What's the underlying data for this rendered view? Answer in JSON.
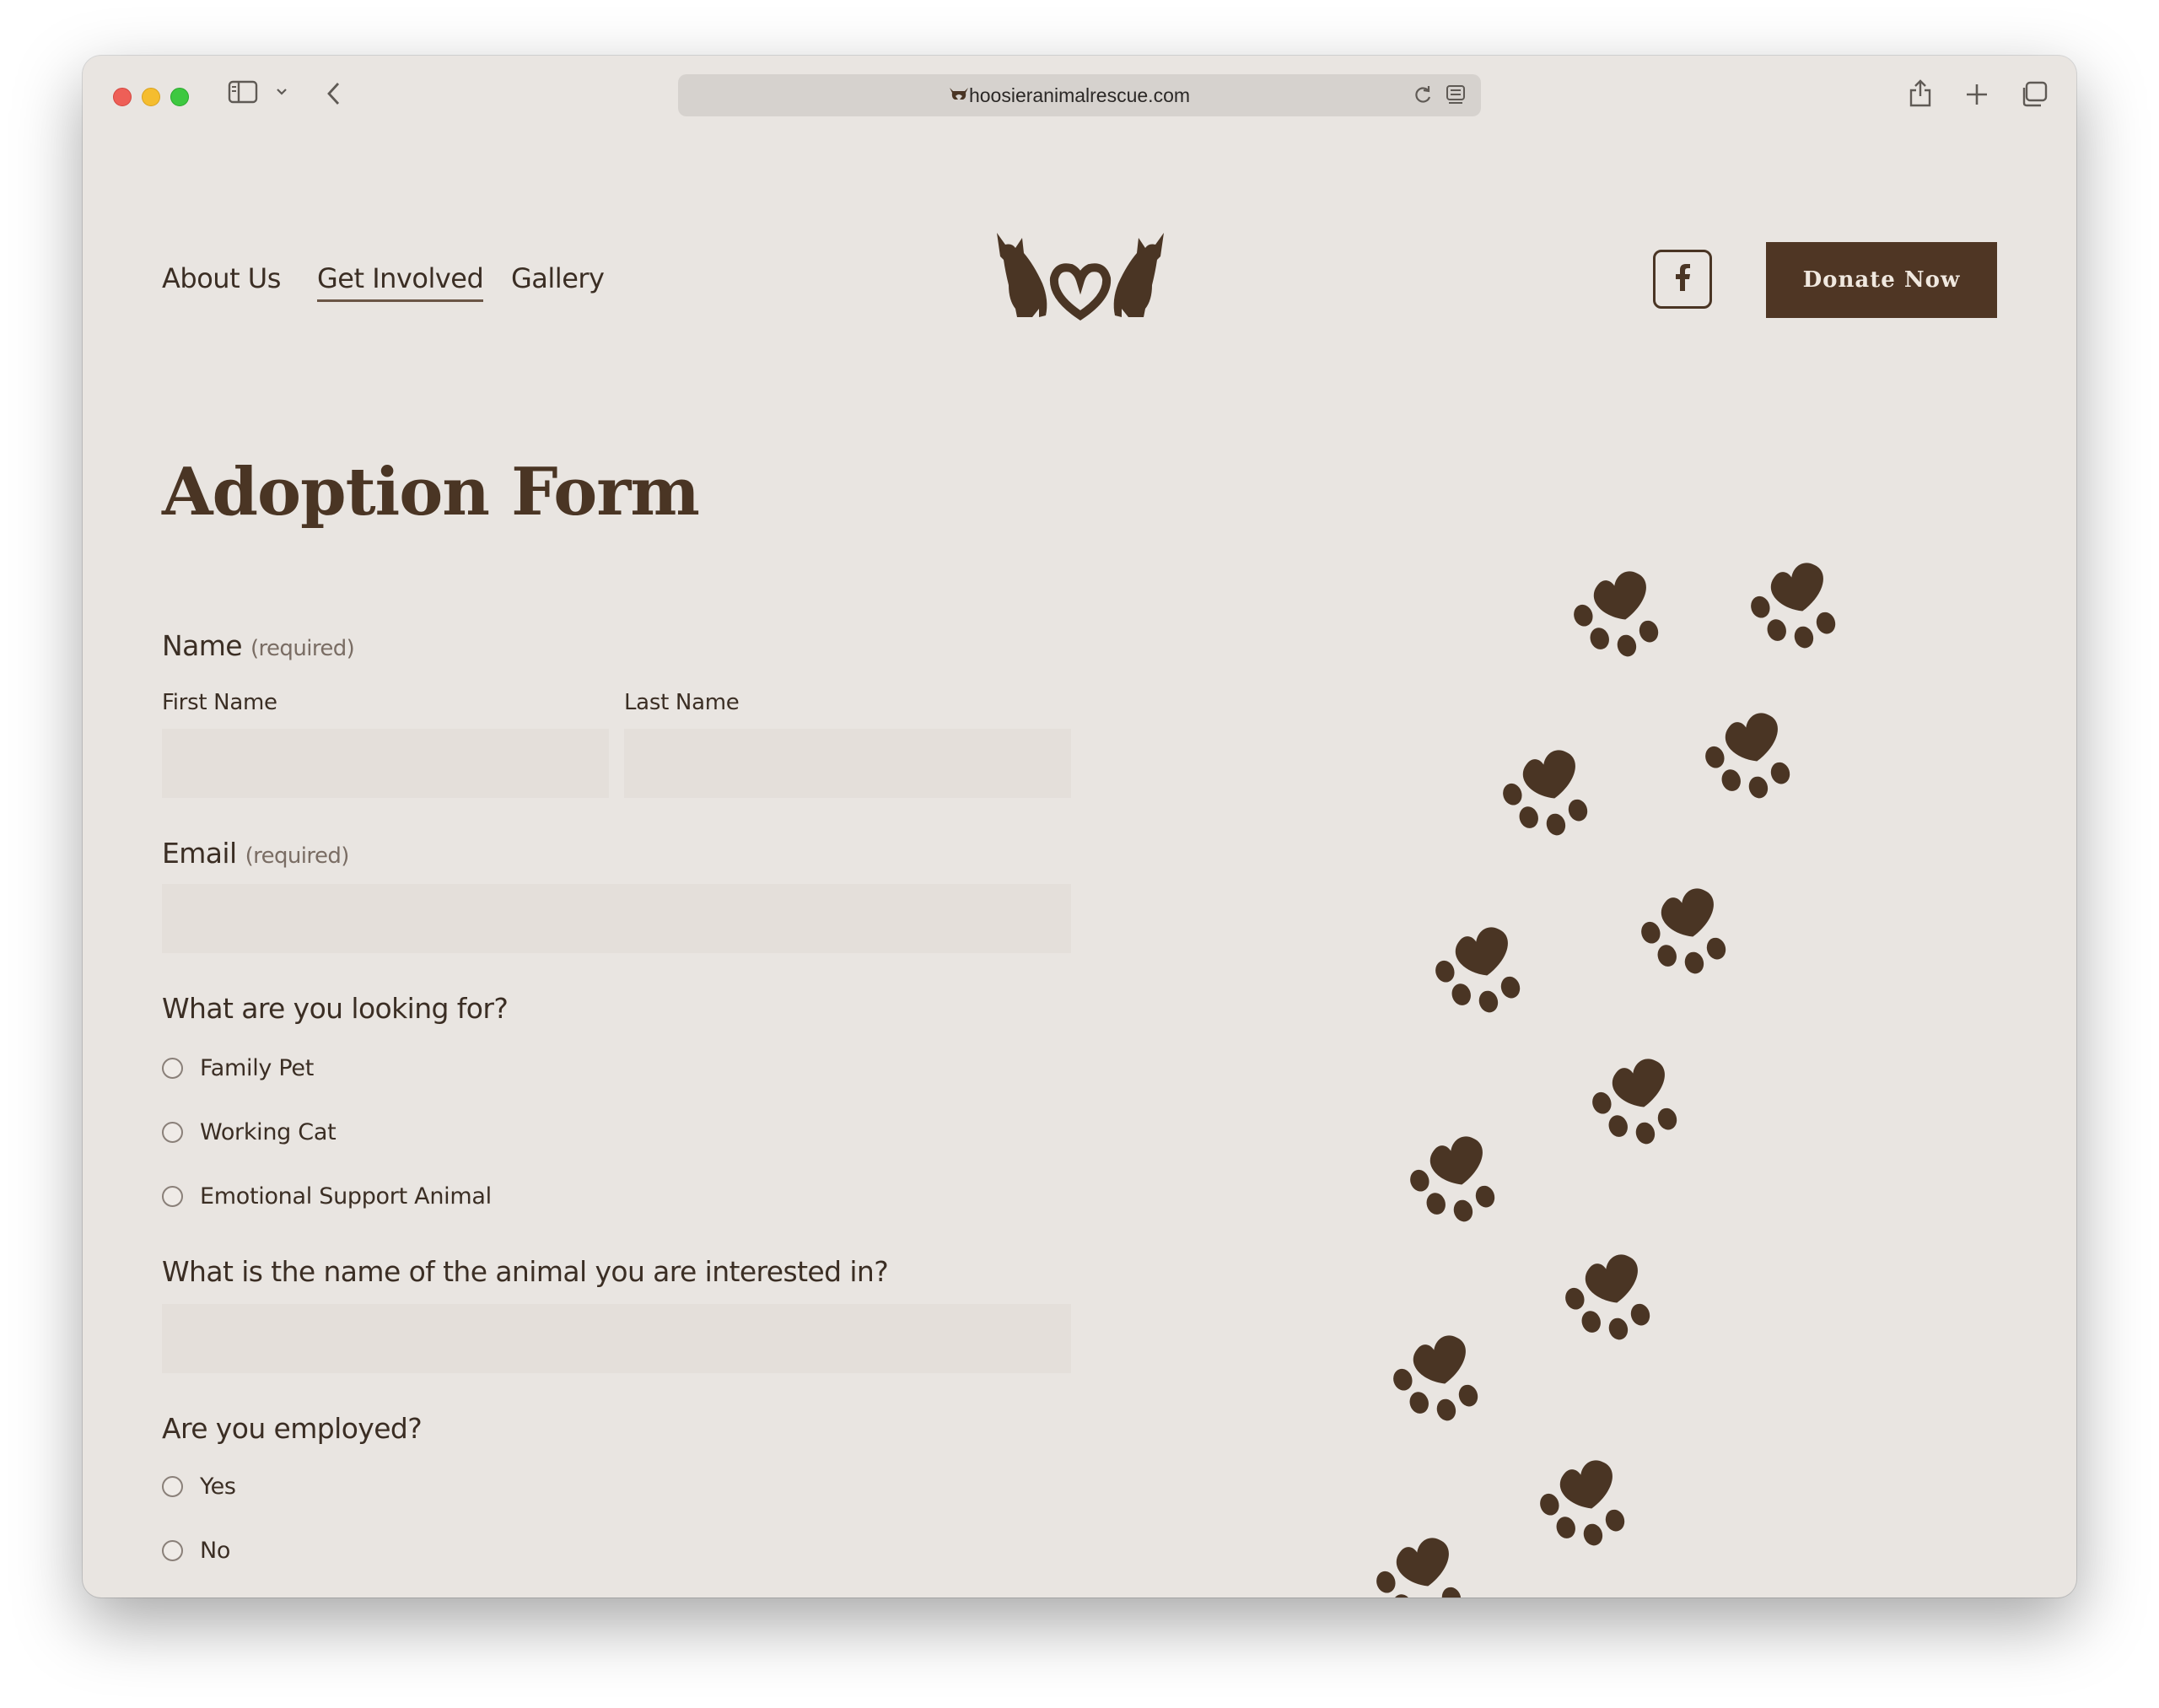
{
  "browser": {
    "url": "hoosieranimalrescue.com"
  },
  "nav": {
    "items": [
      {
        "label": "About Us"
      },
      {
        "label": "Get Involved"
      },
      {
        "label": "Gallery"
      }
    ],
    "donate_label": "Donate Now",
    "facebook_glyph": "f"
  },
  "form": {
    "title": "Adoption Form",
    "name": {
      "label": "Name",
      "required": "(required)",
      "first_label": "First Name",
      "first_value": "",
      "last_label": "Last Name",
      "last_value": ""
    },
    "email": {
      "label": "Email",
      "required": "(required)",
      "value": ""
    },
    "looking_for": {
      "label": "What are you looking for?",
      "options": [
        "Family Pet",
        "Working Cat",
        "Emotional Support Animal"
      ]
    },
    "animal_name": {
      "label": "What is the name of the animal you are interested in?",
      "value": ""
    },
    "employed": {
      "label": "Are you employed?",
      "options": [
        "Yes",
        "No"
      ]
    }
  },
  "colors": {
    "brand_brown": "#4f3624",
    "page_bg": "#e9e5e1",
    "field_bg": "#e4dfda"
  },
  "icons": {
    "logo": "two-cats-heart-icon",
    "decoration": "paw-print-icon"
  }
}
